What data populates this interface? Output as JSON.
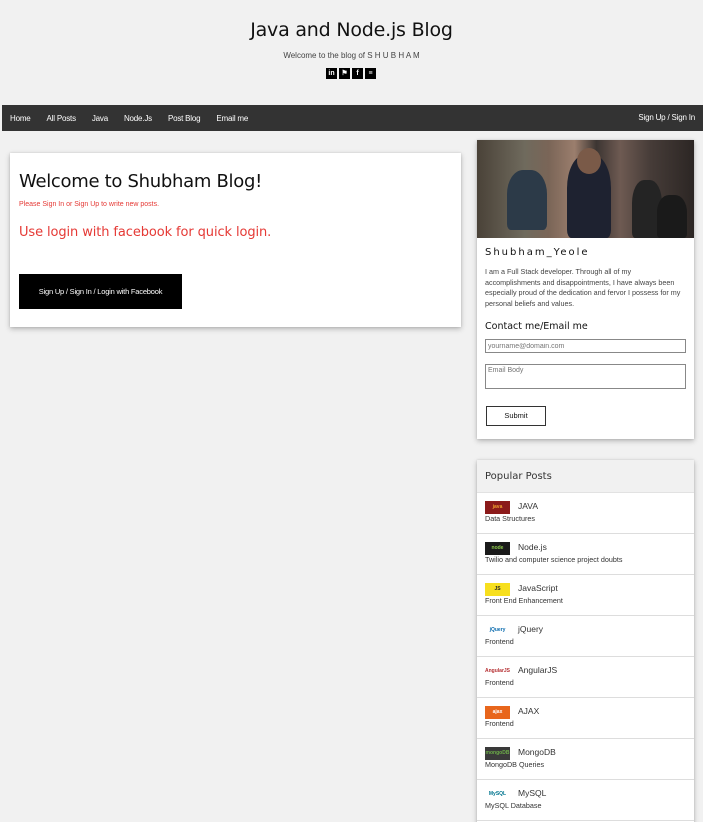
{
  "header": {
    "title": "Java and Node.js Blog",
    "subtitle": "Welcome to the blog of S H U B H A M",
    "social": [
      {
        "icon": "linkedin-icon",
        "glyph": "in"
      },
      {
        "icon": "github-icon",
        "glyph": "⚑"
      },
      {
        "icon": "facebook-icon",
        "glyph": "f"
      },
      {
        "icon": "stackoverflow-icon",
        "glyph": "≡"
      }
    ]
  },
  "nav": {
    "items": [
      "Home",
      "All Posts",
      "Java",
      "Node.Js",
      "Post Blog",
      "Email me"
    ],
    "right": "Sign Up / Sign In"
  },
  "welcome": {
    "title": "Welcome to Shubham Blog!",
    "note": "Please Sign In or Sign Up to write new posts.",
    "facebook_hint": "Use login with facebook for quick login.",
    "button": "Sign Up / Sign In / Login with Facebook"
  },
  "profile": {
    "name": "Shubham_Yeole",
    "bio": "I am a Full Stack developer. Through all of my accomplishments and disappointments, I have always been especially proud of the dedication and fervor I possess for my personal beliefs and values.",
    "contact_title": "Contact me/Email me",
    "email_placeholder": "yourname@domain.com",
    "body_placeholder": "Email Body",
    "submit": "Submit"
  },
  "popular": {
    "title": "Popular Posts",
    "posts": [
      {
        "title": "JAVA",
        "subtitle": "Data Structures",
        "thumb": "java",
        "thumb_bg": "#8b1a1a",
        "thumb_fg": "#f0a030"
      },
      {
        "title": "Node.js",
        "subtitle": "Twilio and computer science project doubts",
        "thumb": "node",
        "thumb_bg": "#1a1a1a",
        "thumb_fg": "#8cc84b"
      },
      {
        "title": "JavaScript",
        "subtitle": "Front End Enhancement",
        "thumb": "JS",
        "thumb_bg": "#f7df1e",
        "thumb_fg": "#222"
      },
      {
        "title": "jQuery",
        "subtitle": "Frontend",
        "thumb": "jQuery",
        "thumb_bg": "#ffffff",
        "thumb_fg": "#0769ad"
      },
      {
        "title": "AngularJS",
        "subtitle": "Frontend",
        "thumb": "AngularJS",
        "thumb_bg": "#ffffff",
        "thumb_fg": "#b52e31"
      },
      {
        "title": "AJAX",
        "subtitle": "Frontend",
        "thumb": "ajax",
        "thumb_bg": "#e8661c",
        "thumb_fg": "#ffffff"
      },
      {
        "title": "MongoDB",
        "subtitle": "MongoDB Queries",
        "thumb": "mongoDB",
        "thumb_bg": "#3a3a3a",
        "thumb_fg": "#6cac48"
      },
      {
        "title": "MySQL",
        "subtitle": "MySQL Database",
        "thumb": "MySQL",
        "thumb_bg": "#ffffff",
        "thumb_fg": "#00758f"
      }
    ]
  }
}
